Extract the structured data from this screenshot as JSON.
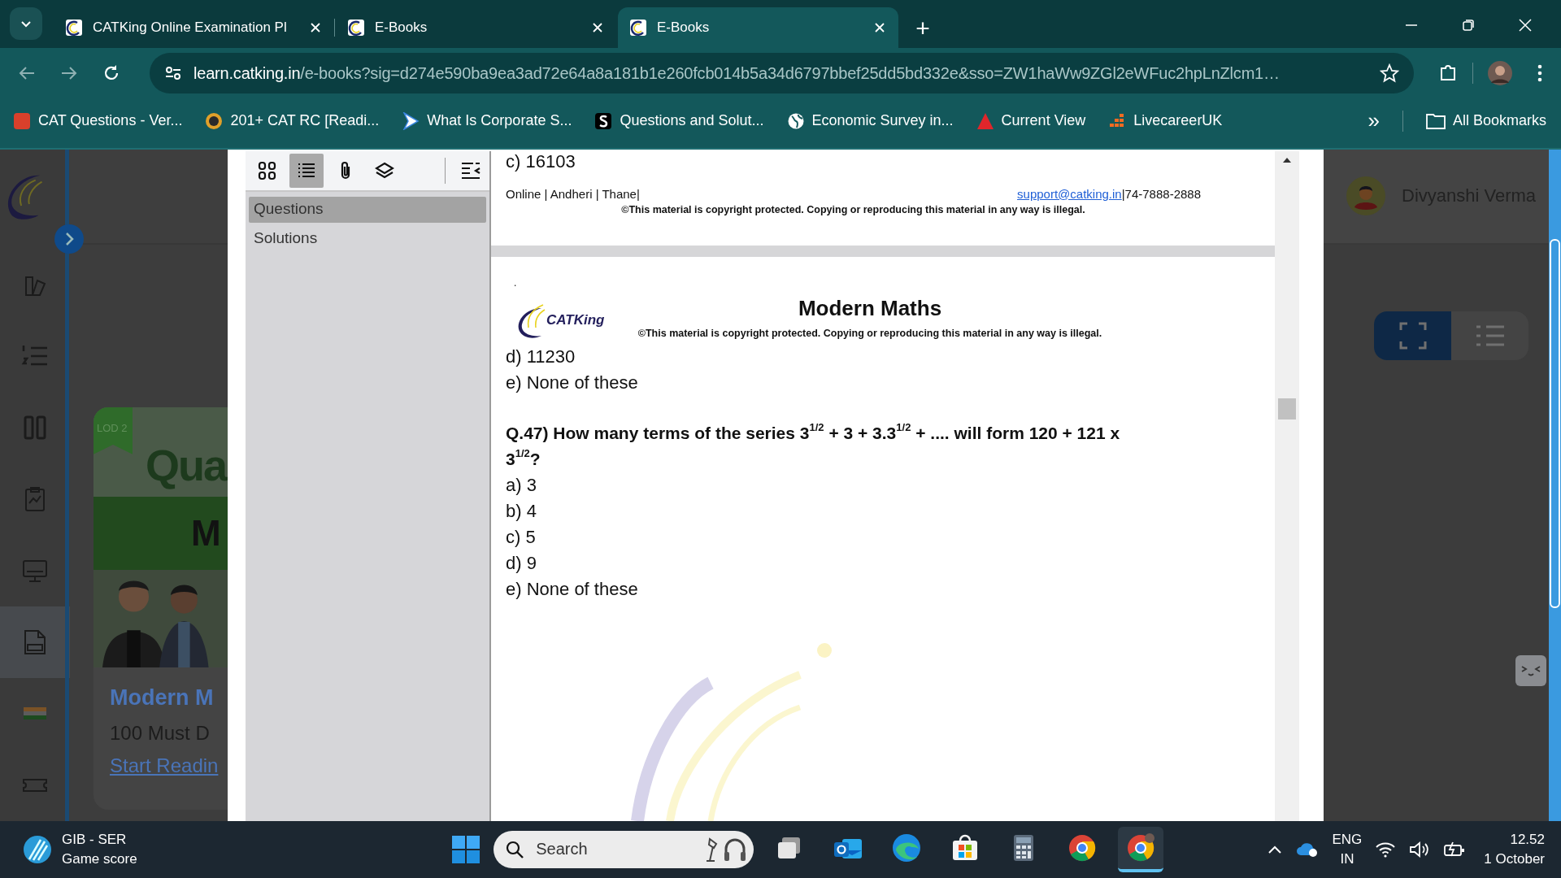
{
  "browser": {
    "tabs": [
      {
        "title": "CATKing Online Examination Pl",
        "selected": false
      },
      {
        "title": "E-Books",
        "selected": false
      },
      {
        "title": "E-Books",
        "selected": true
      }
    ],
    "new_tab": "+",
    "url_host": "learn.catking.in",
    "url_path": "/e-books?sig=d274e590ba9ea3ad72e64a8a181b1e260fcb014b5a34d6797bbef25dd5bd332e&sso=ZW1haWw9ZGl2eWFuc2hpLnZlcm1…",
    "bookmarks": [
      {
        "label": "CAT Questions - Ver...",
        "kind": "red-square"
      },
      {
        "label": "201+ CAT RC [Readi...",
        "kind": "coin"
      },
      {
        "label": "What Is Corporate S...",
        "kind": "play"
      },
      {
        "label": "Questions and Solut...",
        "kind": "s-logo"
      },
      {
        "label": "Economic Survey in...",
        "kind": "globe"
      },
      {
        "label": "Current View",
        "kind": "triangle"
      },
      {
        "label": "LivecareerUK",
        "kind": "dots"
      }
    ],
    "more_bookmarks": "»",
    "all_bookmarks": "All Bookmarks"
  },
  "site": {
    "nav": [
      {
        "kind": "books",
        "selected": false
      },
      {
        "kind": "numbered-list",
        "selected": false
      },
      {
        "kind": "columns",
        "selected": false
      },
      {
        "kind": "clipboard",
        "selected": false
      },
      {
        "kind": "monitor",
        "selected": false
      },
      {
        "kind": "ebook",
        "selected": true
      },
      {
        "kind": "flag",
        "selected": false
      },
      {
        "kind": "ticket",
        "selected": false
      }
    ],
    "card": {
      "ribbon": "LOD 2",
      "cover_title": "Qua",
      "cover_band": "M",
      "title": "Modern M",
      "subtitle": "100 Must D",
      "link": "Start Readin"
    },
    "user_name": "Divyanshi Verma",
    "view_toggle": [
      {
        "kind": "fullscreen",
        "selected": true
      },
      {
        "kind": "list",
        "selected": false
      }
    ]
  },
  "viewer": {
    "tools": [
      {
        "kind": "thumbnails",
        "selected": false
      },
      {
        "kind": "outline",
        "selected": true
      },
      {
        "kind": "attachments",
        "selected": false
      },
      {
        "kind": "layers",
        "selected": false
      }
    ],
    "outline": [
      {
        "label": "Questions",
        "selected": true
      },
      {
        "label": "Solutions",
        "selected": false
      }
    ],
    "previous_page": {
      "last_line": "c) 16103",
      "footer_left": "Online | Andheri | Thane|",
      "footer_email": "support@catking.in",
      "footer_phone": "|74-7888-2888",
      "copyright": "©This material is copyright protected. Copying or reproducing this material in any way is illegal."
    },
    "page": {
      "dot": ".",
      "logo": "CATKing",
      "title": "Modern Maths",
      "copyright": "©This material is copyright protected. Copying or reproducing this material in any way is illegal.",
      "lines": [
        {
          "kind": "option",
          "text": "d) 11230"
        },
        {
          "kind": "option",
          "text": "e) None of these"
        },
        {
          "kind": "question",
          "text": "Q.47) How many terms of the series 3$^{1/2}$ + 3 + 3.3$^{1/2}$ + .... will form 120 + 121 x 3$^{1/2}$?"
        },
        {
          "kind": "option",
          "text": "a) 3"
        },
        {
          "kind": "option",
          "text": "b) 4"
        },
        {
          "kind": "option",
          "text": "c) 5"
        },
        {
          "kind": "option",
          "text": "d) 9"
        },
        {
          "kind": "option",
          "text": "e) None of these"
        }
      ]
    }
  },
  "taskbar": {
    "widget_title": "GIB - SER",
    "widget_subtitle": "Game score",
    "search_placeholder": "Search",
    "apps": [
      {
        "kind": "task-view",
        "active": false
      },
      {
        "kind": "outlook",
        "active": false
      },
      {
        "kind": "edge",
        "active": false
      },
      {
        "kind": "store",
        "active": false
      },
      {
        "kind": "calculator",
        "active": false
      },
      {
        "kind": "chrome",
        "active": false
      },
      {
        "kind": "chrome-profile",
        "active": true
      }
    ],
    "language": "ENG",
    "region": "IN",
    "time": "12.52",
    "date": "1 October"
  }
}
